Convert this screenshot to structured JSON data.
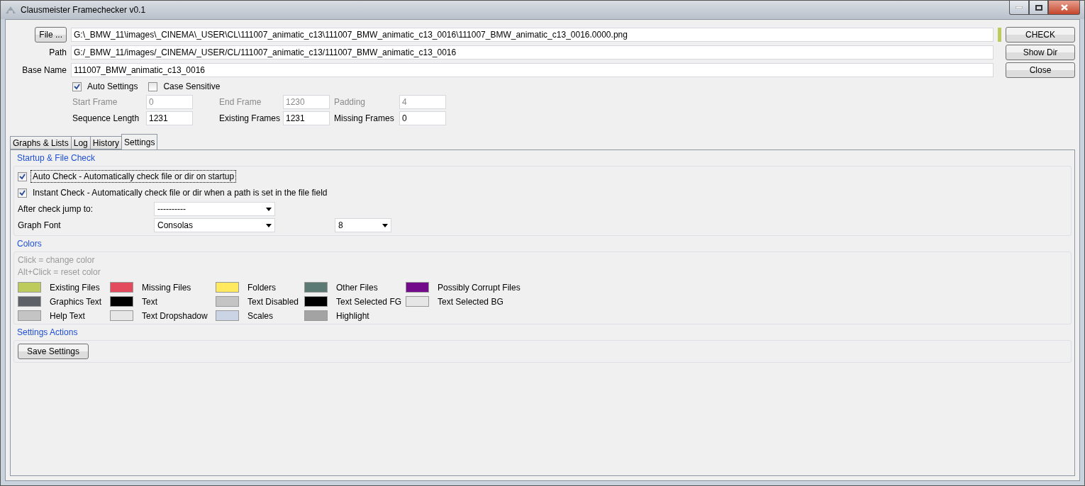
{
  "window": {
    "title": "Clausmeister Framechecker v0.1"
  },
  "file_row": {
    "button": "File ...",
    "value": "G:\\_BMW_11\\images\\_CINEMA\\_USER\\CL\\111007_animatic_c13\\111007_BMW_animatic_c13_0016\\111007_BMW_animatic_c13_0016.0000.png"
  },
  "path_row": {
    "label": "Path",
    "value": "G:/_BMW_11/images/_CINEMA/_USER/CL/111007_animatic_c13/111007_BMW_animatic_c13_0016"
  },
  "base_row": {
    "label": "Base Name",
    "value": "111007_BMW_animatic_c13_0016"
  },
  "actions": [
    "CHECK",
    "Show Dir",
    "Close"
  ],
  "options": [
    {
      "label": "Auto Settings",
      "checked": true
    },
    {
      "label": "Case Sensitive",
      "checked": false
    }
  ],
  "frame_fields": [
    [
      {
        "label": "Start Frame",
        "value": "0",
        "disabled": true
      },
      {
        "label": "End Frame",
        "value": "1230",
        "disabled": true
      },
      {
        "label": "Padding",
        "value": "4",
        "disabled": true
      }
    ],
    [
      {
        "label": "Sequence Length",
        "value": "1231",
        "disabled": false
      },
      {
        "label": "Existing Frames",
        "value": "1231",
        "disabled": false
      },
      {
        "label": "Missing Frames",
        "value": "0",
        "disabled": false
      }
    ]
  ],
  "tabs": [
    {
      "label": "Graphs & Lists",
      "selected": false
    },
    {
      "label": "Log",
      "selected": false
    },
    {
      "label": "History",
      "selected": false
    },
    {
      "label": "Settings",
      "selected": true
    }
  ],
  "startup": {
    "title": "Startup & File Check",
    "checks": [
      {
        "label": "Auto Check - Automatically check file or dir on startup",
        "checked": true,
        "focused": true
      },
      {
        "label": "Instant Check - Automatically check file or dir when a path is set in the file field",
        "checked": true,
        "focused": false
      }
    ],
    "jump": {
      "label": "After check jump to:",
      "value": "----------"
    },
    "font": {
      "label": "Graph Font",
      "value": "Consolas",
      "size": "8"
    }
  },
  "colors": {
    "title": "Colors",
    "help": [
      "Click = change color",
      "Alt+Click = reset color"
    ],
    "items": [
      {
        "label": "Existing Files",
        "color": "#bccb5c"
      },
      {
        "label": "Missing Files",
        "color": "#e44a5e"
      },
      {
        "label": "Folders",
        "color": "#ffe95e"
      },
      {
        "label": "Other Files",
        "color": "#5b7a73"
      },
      {
        "label": "Possibly Corrupt Files",
        "color": "#720a8a"
      },
      {
        "label": "Graphics Text",
        "color": "#5f6168"
      },
      {
        "label": "Text",
        "color": "#000000"
      },
      {
        "label": "Text Disabled",
        "color": "#c4c4c4"
      },
      {
        "label": "Text Selected FG",
        "color": "#000000"
      },
      {
        "label": "Text Selected BG",
        "color": "#e6e6e6"
      },
      {
        "label": "Help Text",
        "color": "#c4c4c4"
      },
      {
        "label": "Text Dropshadow",
        "color": "#e6e6e6"
      },
      {
        "label": "Scales",
        "color": "#cbd4e5"
      },
      {
        "label": "Highlight",
        "color": "#a3a3a3"
      }
    ]
  },
  "settings_actions": {
    "title": "Settings Actions",
    "button": "Save Settings"
  }
}
